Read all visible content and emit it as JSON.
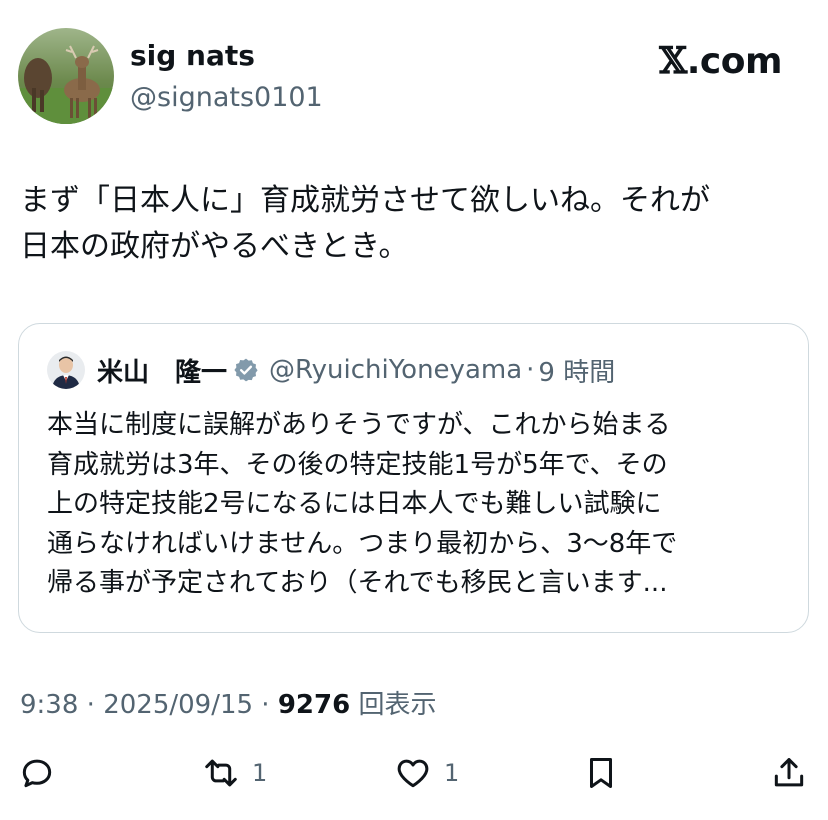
{
  "author": {
    "display_name": "sig nats",
    "handle": "@signats0101",
    "avatar_icon": "deer-avatar"
  },
  "brand": {
    "prefix": "𝕏",
    "suffix": ".com"
  },
  "tweet": {
    "lines": [
      "まず「日本人に」育成就労させて欲しいね。それが",
      "日本の政府がやるべきとき。"
    ]
  },
  "quote": {
    "display_name": "米山　隆一",
    "verified_icon": "verified-badge-icon",
    "handle": "@RyuichiYoneyama",
    "separator": "·",
    "time": "9 時間",
    "lines": [
      "本当に制度に誤解がありそうですが、これから始まる",
      "育成就労は3年、その後の特定技能1号が5年で、その",
      "上の特定技能2号になるには日本人でも難しい試験に",
      "通らなければいけません。つまり最初から、3〜8年で",
      "帰る事が予定されており（それでも移民と言います..."
    ]
  },
  "meta": {
    "time": "9:38",
    "sep1": " · ",
    "date": "2025/09/15",
    "sep2": " · ",
    "views_count": "9276",
    "views_label": " 回表示"
  },
  "actions": {
    "reply_icon": "reply-icon",
    "retweet_icon": "retweet-icon",
    "retweet_count": "1",
    "like_icon": "heart-icon",
    "like_count": "1",
    "bookmark_icon": "bookmark-icon",
    "share_icon": "share-icon"
  },
  "colors": {
    "text": "#0f1419",
    "secondary": "#536471",
    "border": "#cfd9de"
  }
}
